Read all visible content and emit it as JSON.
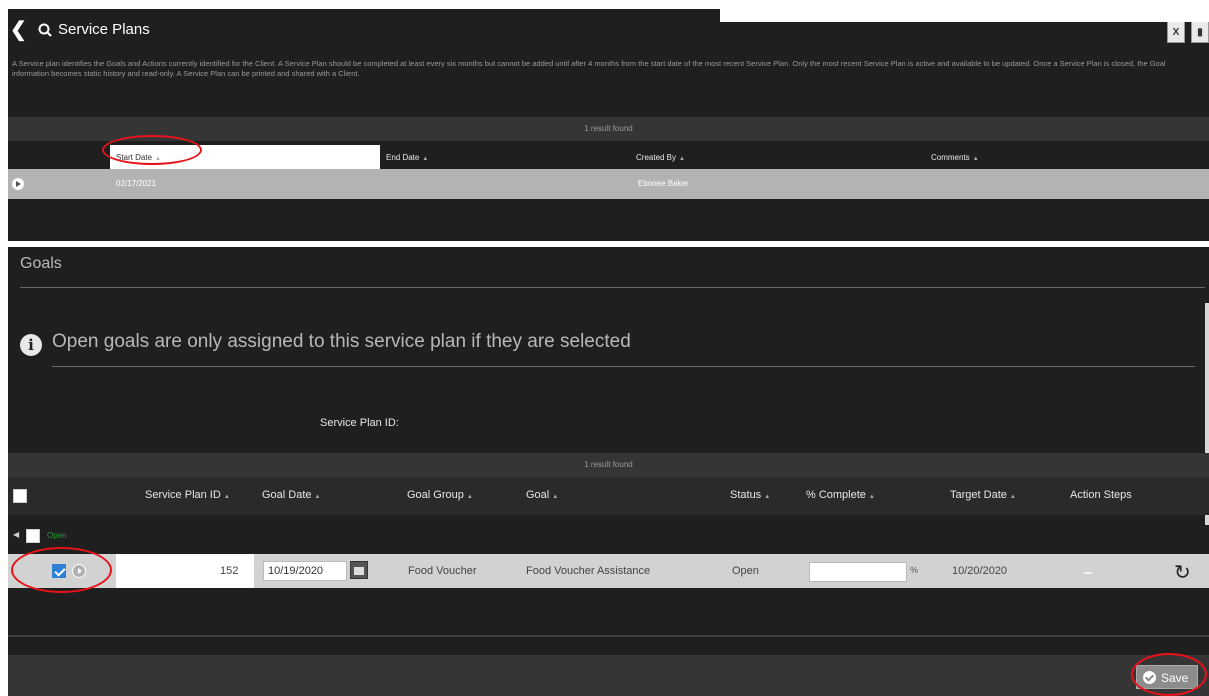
{
  "header": {
    "top_link": "",
    "title": "Service Plans",
    "description": "A Service plan identifies the Goals and Actions currently identified for the Client. A Service Plan should be completed at least every six months but cannot be added until after 4 months from the start date of the most recent Service Plan. Only the most recent Service Plan is active and available to be updated. Once a Service Plan is closed, the Goal information becomes static history and read-only. A Service Plan can be printed and shared with a Client.",
    "export_icons": [
      "excel-export-icon",
      "print-icon"
    ]
  },
  "service_plans": {
    "results_text": "1 result found",
    "columns": [
      "Start Date",
      "End Date",
      "Created By",
      "Comments"
    ],
    "rows": [
      {
        "start_date": "02/17/2021",
        "end_date": "",
        "created_by": "Ebonee Baker",
        "comments": ""
      }
    ]
  },
  "goals": {
    "title": "Goals",
    "info_text": "Open goals are only assigned to this service plan if they are selected",
    "service_plan_id_label": "Service Plan ID:",
    "results_text": "1 result found",
    "columns": [
      "Service Plan ID",
      "Goal Date",
      "Goal Group",
      "Goal",
      "Status",
      "% Complete",
      "Target Date",
      "Action Steps"
    ],
    "group_label": "Open",
    "rows": [
      {
        "selected": true,
        "service_plan_id": "152",
        "goal_date": "10/19/2020",
        "goal_group": "Food Voucher",
        "goal": "Food Voucher Assistance",
        "status": "Open",
        "percent_complete": "",
        "percent_sign": "%",
        "target_date": "10/20/2020",
        "action_steps": ""
      }
    ]
  },
  "footer": {
    "save_label": "Save"
  },
  "colors": {
    "panel_bg": "#1f1f1f",
    "highlight_circle": "#e8121b",
    "checkbox_checked": "#2f7fd6",
    "group_label_green": "#2f9a3a"
  }
}
